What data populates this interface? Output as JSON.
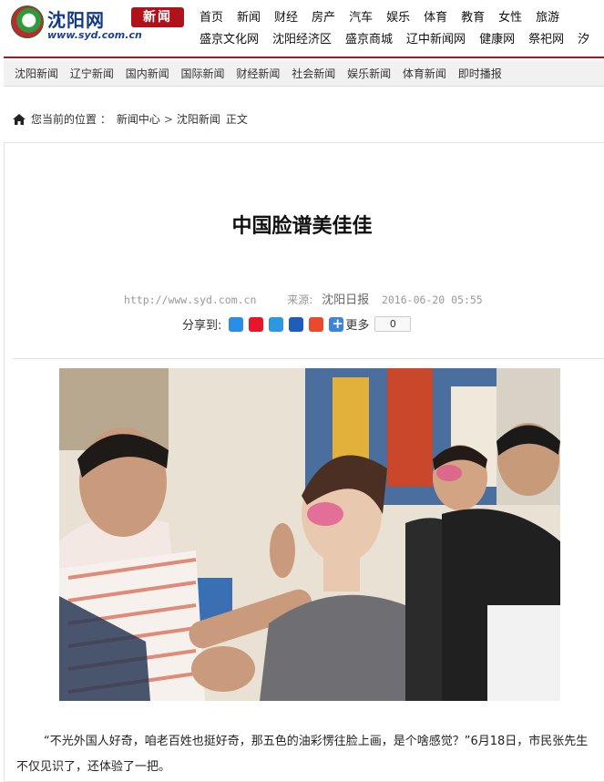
{
  "site": {
    "logo_name": "沈阳网",
    "logo_badge": "新闻",
    "logo_url": "www.syd.com.cn"
  },
  "nav_primary": [
    "首页",
    "新闻",
    "财经",
    "房产",
    "汽车",
    "娱乐",
    "体育",
    "教育",
    "女性",
    "旅游"
  ],
  "nav_secondary": [
    "盛京文化网",
    "沈阳经济区",
    "盛京商城",
    "辽中新闻网",
    "健康网",
    "祭祀网",
    "汐"
  ],
  "subnav": [
    "沈阳新闻",
    "辽宁新闻",
    "国内新闻",
    "国际新闻",
    "财经新闻",
    "社会新闻",
    "娱乐新闻",
    "体育新闻",
    "即时播报"
  ],
  "breadcrumb": {
    "prefix": "您当前的位置 ：",
    "level1": "新闻中心",
    "separator": ">",
    "level2": "沈阳新闻",
    "current": "正文"
  },
  "article": {
    "title": "中国脸谱美佳佳",
    "url": "http://www.syd.com.cn",
    "source_label": "来源:",
    "source_name": "沈阳日报",
    "date": "2016-06-20 05:55",
    "share_label": "分享到:",
    "share_icons": [
      "qzone-icon",
      "weibo-icon",
      "tqq-icon",
      "renren-icon",
      "tencent-weibo-icon",
      "more-icon"
    ],
    "share_more": "更多",
    "share_count": "0",
    "paragraph": "“不光外国人好奇，咱老百姓也挺好奇，那五色的油彩愣往脸上画，是个啥感觉？”6月18日，市民张先生不仅见识了，还体验了一把。"
  },
  "colors": {
    "brand_red": "#b0121b",
    "brand_blue": "#123a8a",
    "header_rule": "#9c1c22"
  }
}
